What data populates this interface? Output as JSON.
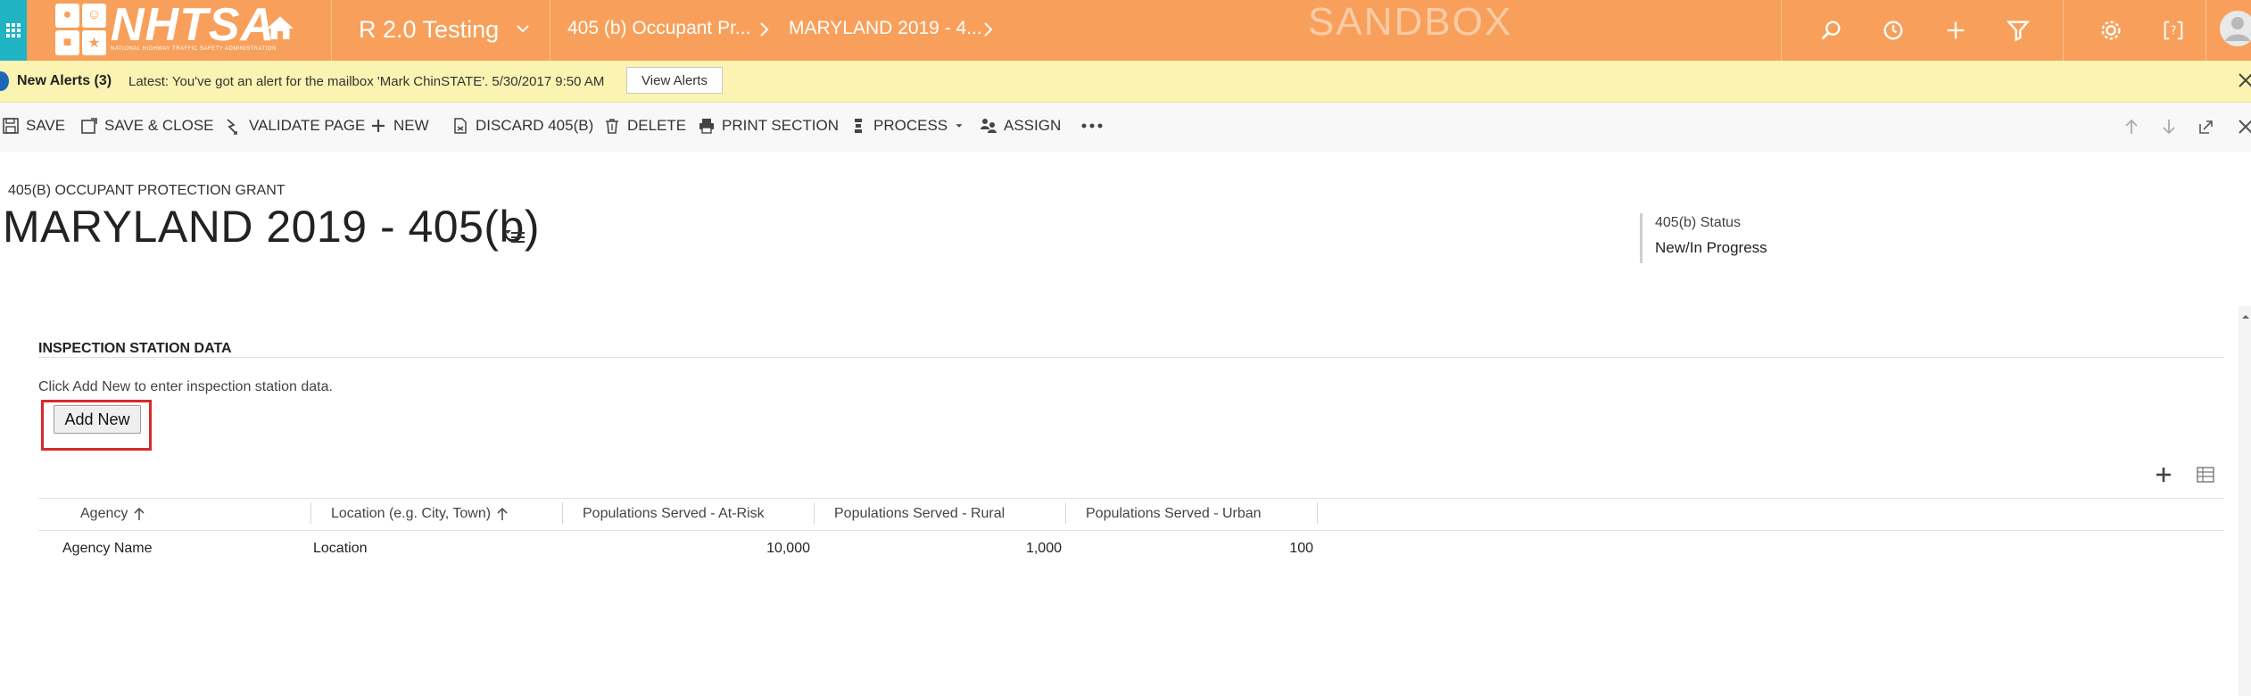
{
  "topnav": {
    "logo_text": "NHTSA",
    "logo_subtitle": "NATIONAL HIGHWAY TRAFFIC SAFETY ADMINISTRATION",
    "app_title": "R 2.0 Testing",
    "breadcrumbs": [
      "405 (b) Occupant Pr...",
      "MARYLAND 2019 - 4..."
    ],
    "environment_label": "SANDBOX",
    "colors": {
      "bar": "#f8a05b",
      "waffle": "#20b3c4"
    },
    "icons": [
      "waffle-icon",
      "home-icon",
      "search-icon",
      "history-icon",
      "plus-icon",
      "filter-icon",
      "gear-icon",
      "help-icon",
      "user-avatar-icon"
    ]
  },
  "alerts": {
    "title": "New Alerts (3)",
    "message": "Latest: You've got an alert for the mailbox 'Mark ChinSTATE'. 5/30/2017 9:50 AM",
    "button_label": "View Alerts"
  },
  "commandbar": {
    "save": "SAVE",
    "save_close": "SAVE & CLOSE",
    "validate": "VALIDATE PAGE",
    "new": "NEW",
    "discard": "DISCARD 405(B)",
    "delete": "DELETE",
    "print": "PRINT SECTION",
    "process": "PROCESS",
    "assign": "ASSIGN"
  },
  "header": {
    "entity_type": "405(B) OCCUPANT PROTECTION GRANT",
    "record_title": "MARYLAND 2019 - 405(b)",
    "status_label": "405(b) Status",
    "status_value": "New/In Progress"
  },
  "section": {
    "title": "INSPECTION STATION DATA",
    "hint": "Click Add New to enter inspection station data.",
    "add_new_label": "Add New"
  },
  "grid": {
    "columns": [
      "Agency",
      "Location (e.g. City, Town)",
      "Populations Served - At-Risk",
      "Populations Served - Rural",
      "Populations Served - Urban"
    ],
    "rows": [
      {
        "agency": "Agency Name",
        "location": "Location",
        "at_risk": "10,000",
        "rural": "1,000",
        "urban": "100"
      }
    ]
  }
}
